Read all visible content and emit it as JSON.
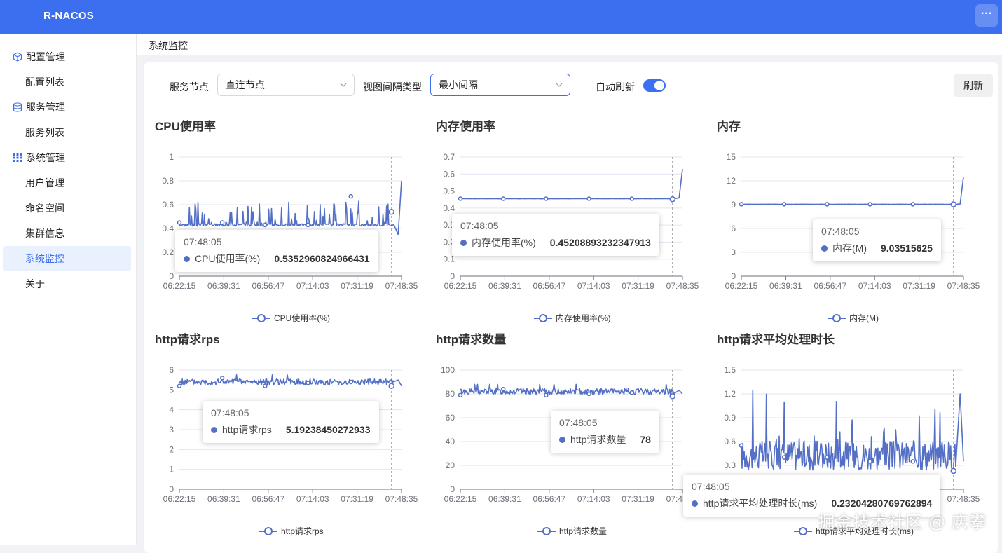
{
  "app": {
    "title": "R-NACOS",
    "more_icon": "ellipsis-icon"
  },
  "sidebar": {
    "groups": [
      {
        "label": "配置管理",
        "icon": "cube-icon",
        "items": [
          "配置列表"
        ]
      },
      {
        "label": "服务管理",
        "icon": "database-icon",
        "items": [
          "服务列表"
        ]
      },
      {
        "label": "系统管理",
        "icon": "grid-icon",
        "items": [
          "用户管理",
          "命名空间",
          "集群信息",
          "系统监控",
          "关于"
        ]
      }
    ],
    "active_item": "系统监控"
  },
  "breadcrumb": "系统监控",
  "filters": {
    "node_label": "服务节点",
    "node_value": "直连节点",
    "interval_label": "视图间隔类型",
    "interval_value": "最小间隔",
    "auto_refresh_label": "自动刷新",
    "auto_refresh_on": true,
    "refresh_button": "刷新"
  },
  "colors": {
    "accent": "#3b6ff0",
    "series": "#5470c6"
  },
  "chart_data": [
    {
      "type": "line",
      "title": "CPU使用率",
      "series_name": "CPU使用率(%)",
      "yticks": [
        "0",
        "0.2",
        "0.4",
        "0.6",
        "0.8",
        "1"
      ],
      "ylim": [
        0,
        1
      ],
      "xticks": [
        "06:22:15",
        "06:39:31",
        "06:56:47",
        "07:14:03",
        "07:31:19",
        "07:48:35"
      ],
      "baseline": 0.43,
      "noise": "spiky",
      "markers": [
        0.45,
        0.45,
        0.43,
        0.43,
        0.67,
        0.54
      ],
      "tail": [
        0.35,
        0.8
      ],
      "tooltip": {
        "time": "07:48:05",
        "value": "0.5352960824966431"
      }
    },
    {
      "type": "line",
      "title": "内存使用率",
      "series_name": "内存使用率(%)",
      "yticks": [
        "0",
        "0.1",
        "0.2",
        "0.3",
        "0.4",
        "0.5",
        "0.6",
        "0.7"
      ],
      "ylim": [
        0,
        0.7
      ],
      "xticks": [
        "06:22:15",
        "06:39:31",
        "06:56:47",
        "07:14:03",
        "07:31:19",
        "07:48:35"
      ],
      "baseline": 0.455,
      "noise": "flat",
      "markers": [
        0.455,
        0.455,
        0.455,
        0.455,
        0.455,
        0.452
      ],
      "tail": [
        0.46,
        0.63
      ],
      "tooltip": {
        "time": "07:48:05",
        "value": "0.45208893232347913"
      }
    },
    {
      "type": "line",
      "title": "内存",
      "series_name": "内存(M)",
      "yticks": [
        "0",
        "3",
        "6",
        "9",
        "12",
        "15"
      ],
      "ylim": [
        0,
        15
      ],
      "xticks": [
        "06:22:15",
        "06:39:31",
        "06:56:47",
        "07:14:03",
        "07:31:19",
        "07:48:35"
      ],
      "baseline": 9.05,
      "noise": "flat",
      "markers": [
        9.05,
        9.05,
        9.05,
        9.05,
        9.05,
        9.04
      ],
      "tail": [
        9.1,
        12.5
      ],
      "tooltip": {
        "time": "07:48:05",
        "value": "9.03515625"
      }
    },
    {
      "type": "line",
      "title": "http请求rps",
      "series_name": "http请求rps",
      "yticks": [
        "0",
        "1",
        "2",
        "3",
        "4",
        "5",
        "6"
      ],
      "ylim": [
        0,
        6
      ],
      "xticks": [
        "06:22:15",
        "06:39:31",
        "06:56:47",
        "07:14:03",
        "07:31:19",
        "07:48:35"
      ],
      "baseline": 5.4,
      "noise": "band",
      "markers": [
        5.2,
        5.6,
        5.2,
        5.35,
        5.4,
        5.2
      ],
      "tail": [
        5.5,
        5.2
      ],
      "tooltip": {
        "time": "07:48:05",
        "value": "5.19238450272933"
      }
    },
    {
      "type": "line",
      "title": "http请求数量",
      "series_name": "http请求数量",
      "yticks": [
        "0",
        "20",
        "40",
        "60",
        "80",
        "100"
      ],
      "ylim": [
        0,
        100
      ],
      "xticks": [
        "06:22:15",
        "06:39:31",
        "06:56:47",
        "07:14:03",
        "07:31:19",
        "07:48:35"
      ],
      "baseline": 82,
      "noise": "band",
      "markers": [
        79,
        84,
        79,
        80,
        81,
        78
      ],
      "tail": [
        83,
        80
      ],
      "tooltip": {
        "time": "07:48:05",
        "value": "78"
      }
    },
    {
      "type": "line",
      "title": "http请求平均处理时长",
      "series_name": "http请求平均处理时长(ms)",
      "yticks": [
        "0",
        "0.3",
        "0.6",
        "0.9",
        "1.2",
        "1.5"
      ],
      "ylim": [
        0,
        1.5
      ],
      "xticks": [
        "06:22:15",
        "06:39:31",
        "06:56:47",
        "07:14:03",
        "07:31:19",
        "07:48:35"
      ],
      "baseline": 0.35,
      "noise": "wild",
      "markers": [
        0.55,
        0.4,
        0.4,
        0.35,
        0.35,
        0.23
      ],
      "tail": [
        1.2,
        0.35
      ],
      "tooltip": {
        "time": "07:48:05",
        "value": "0.23204280769762894"
      }
    }
  ],
  "watermark": "掘金技术社区 @ 庆攀"
}
